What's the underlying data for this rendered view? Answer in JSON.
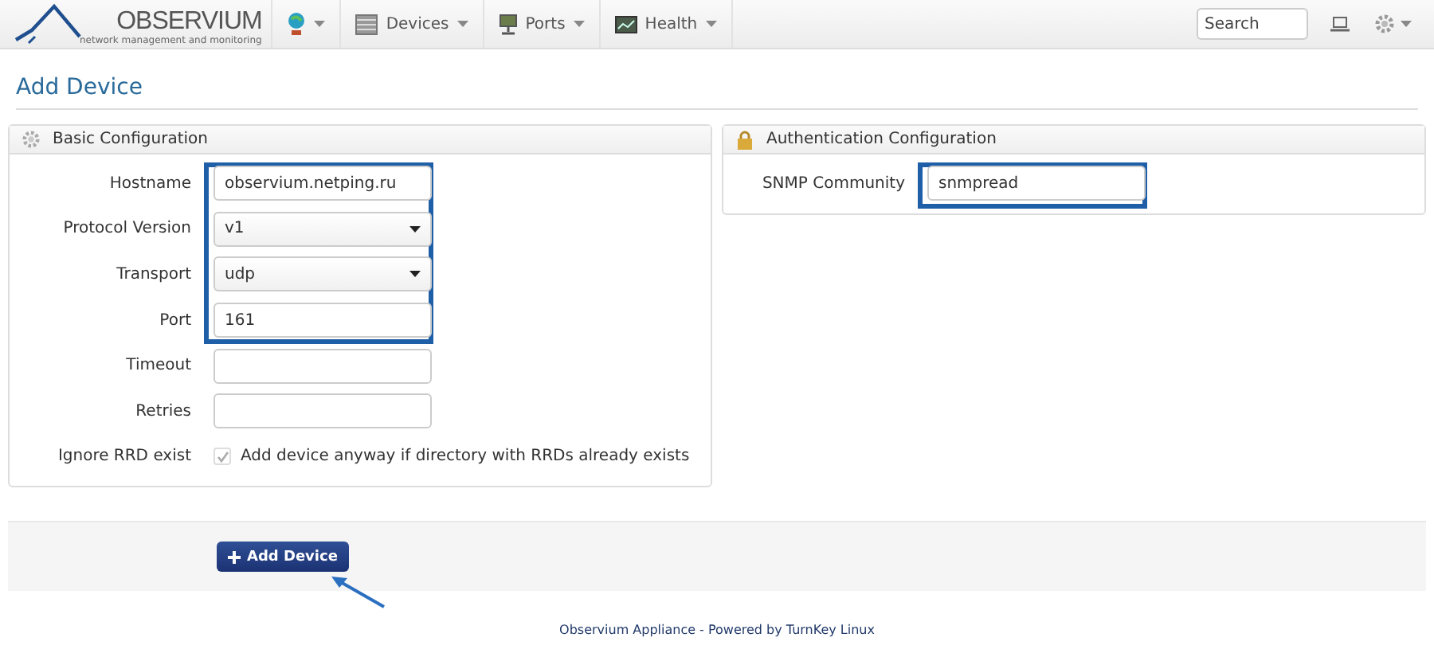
{
  "navbar": {
    "logo": {
      "name": "OBSERVIUM",
      "tagline": "network management and monitoring"
    },
    "menus": [
      {
        "kind": "globe"
      },
      {
        "kind": "devices",
        "label": "Devices"
      },
      {
        "kind": "ports",
        "label": "Ports"
      },
      {
        "kind": "health",
        "label": "Health"
      }
    ],
    "search": {
      "placeholder": "Search"
    }
  },
  "page_title": "Add Device",
  "panels": [
    {
      "kind": "basic",
      "title": "Basic Configuration",
      "fields": [
        {
          "label": "Hostname",
          "kind": "text",
          "value": "observium.netping.ru",
          "highlighted": true
        },
        {
          "label": "Protocol Version",
          "kind": "select",
          "value": "v1",
          "highlighted": true
        },
        {
          "label": "Transport",
          "kind": "select",
          "value": "udp",
          "highlighted": true
        },
        {
          "label": "Port",
          "kind": "text",
          "value": "161",
          "highlighted": true
        },
        {
          "label": "Timeout",
          "kind": "text",
          "highlighted": false
        },
        {
          "label": "Retries",
          "kind": "text",
          "highlighted": false
        },
        {
          "label": "Ignore RRD exist",
          "kind": "checkbox",
          "checked": true,
          "disabled": true,
          "text": "Add device anyway if directory with RRDs already exists",
          "highlighted": false
        }
      ]
    },
    {
      "kind": "auth",
      "title": "Authentication Configuration",
      "fields": [
        {
          "label": "SNMP Community",
          "kind": "text",
          "value": "snmpread",
          "highlighted": true
        }
      ]
    }
  ],
  "submit": {
    "label": "Add Device"
  },
  "footer": {
    "first_link": "Observium Appliance",
    "middle": "- Powered by",
    "second_link": "TurnKey Linux"
  }
}
